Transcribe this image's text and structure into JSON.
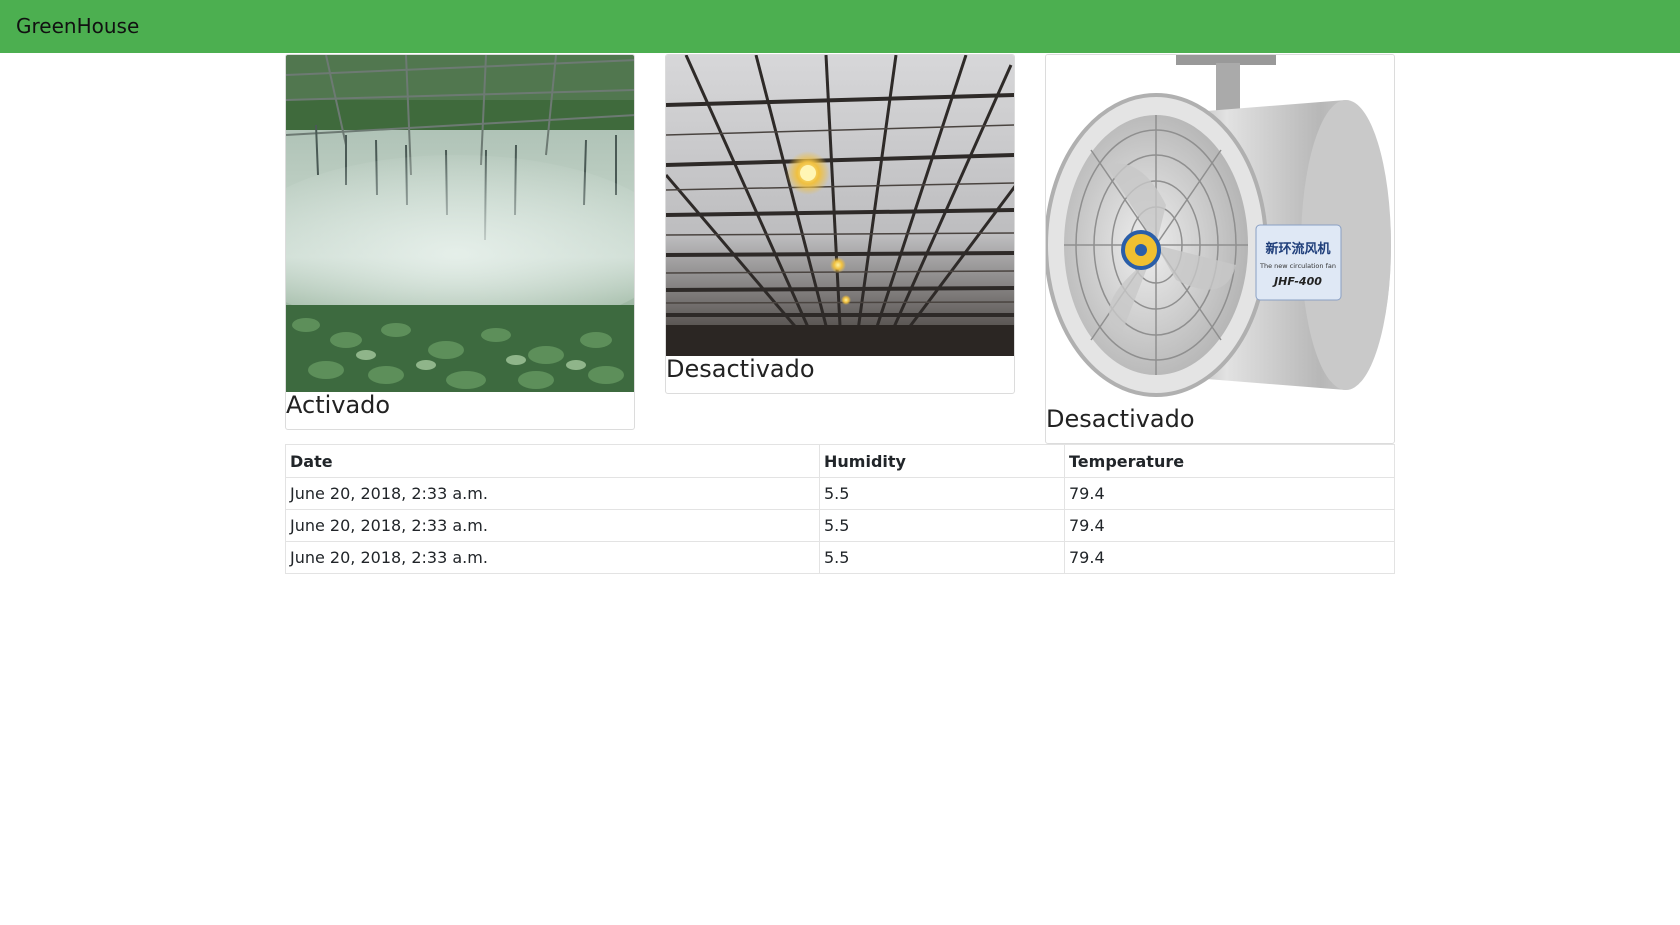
{
  "navbar": {
    "brand": "GreenHouse",
    "color": "#4caf50"
  },
  "devices": [
    {
      "image": "greenhouse-misting-photo",
      "status": "Activado"
    },
    {
      "image": "greenhouse-lighting-photo",
      "status": "Desactivado"
    },
    {
      "image": "circulation-fan-photo",
      "status": "Desactivado",
      "image_text": [
        "新环流风机",
        "The new circulation fan",
        "JHF-400"
      ]
    }
  ],
  "table": {
    "headers": [
      "Date",
      "Humidity",
      "Temperature"
    ],
    "rows": [
      [
        "June 20, 2018, 2:33 a.m.",
        "5.5",
        "79.4"
      ],
      [
        "June 20, 2018, 2:33 a.m.",
        "5.5",
        "79.4"
      ],
      [
        "June 20, 2018, 2:33 a.m.",
        "5.5",
        "79.4"
      ]
    ]
  }
}
